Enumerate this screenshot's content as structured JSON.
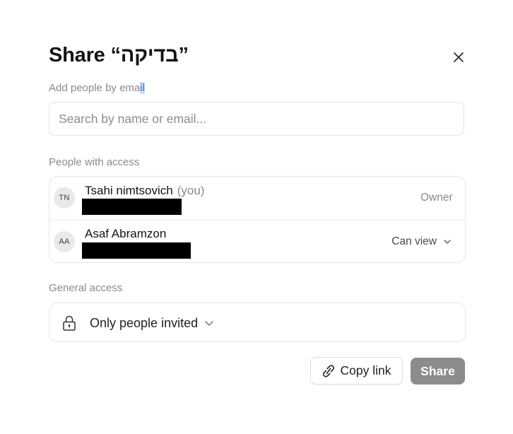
{
  "dialog": {
    "title": "Share “בדיקה”",
    "add_label_prefix": "Add people by ema",
    "add_label_selected": "il",
    "search_placeholder": "Search by name or email...",
    "people_label": "People with access",
    "people": [
      {
        "initials": "TN",
        "name": "Tsahi nimtsovich",
        "suffix": "(you)",
        "role": "Owner"
      },
      {
        "initials": "AA",
        "name": "Asaf Abramzon",
        "role": "Can view"
      }
    ],
    "general_label": "General access",
    "general_access": "Only people invited",
    "copy_link": "Copy link",
    "share": "Share"
  },
  "icons": {
    "close": "close-icon",
    "lock": "lock-icon",
    "link": "link-icon",
    "chevron": "chevron-down-icon"
  },
  "colors": {
    "share_button": "#8c8c8c",
    "selection": "#cfe0fb"
  }
}
